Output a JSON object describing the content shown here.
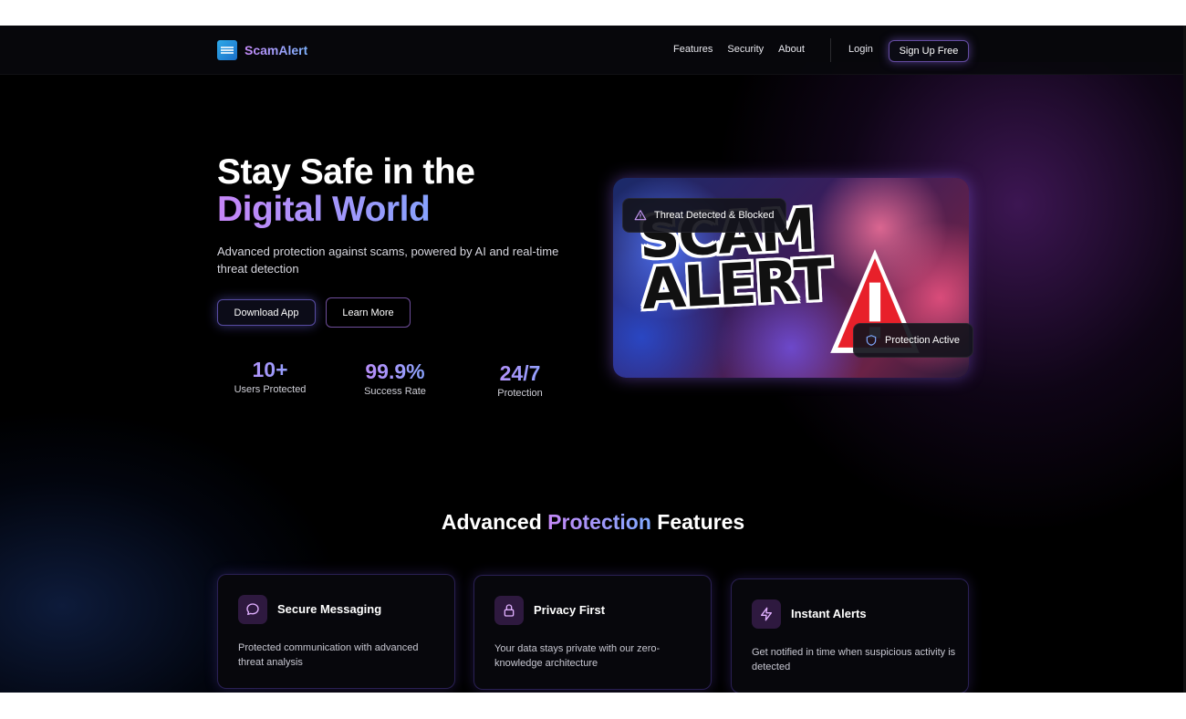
{
  "nav": {
    "brand": "ScamAlert",
    "links": [
      "Features",
      "Security",
      "About"
    ],
    "login": "Login",
    "signup": "Sign Up Free"
  },
  "hero": {
    "title_line1": "Stay Safe in the",
    "title_line2": "Digital World",
    "subtitle": "Advanced protection against scams, powered by AI and real-time threat detection",
    "download_button": "Download App",
    "learn_button": "Learn More",
    "stats": [
      {
        "value": "10+",
        "label": "Users Protected"
      },
      {
        "value": "99.9%",
        "label": "Success Rate"
      },
      {
        "value": "24/7",
        "label": "Protection"
      }
    ],
    "image": {
      "text_line1": "SCAM",
      "text_line2": "ALERT",
      "threat_badge": "Threat Detected & Blocked",
      "active_badge": "Protection Active"
    }
  },
  "features": {
    "title_pre": "Advanced ",
    "title_accent": "Protection",
    "title_post": " Features",
    "cards": [
      {
        "icon": "message-icon",
        "title": "Secure Messaging",
        "description": "Protected communication with advanced threat analysis"
      },
      {
        "icon": "lock-icon",
        "title": "Privacy First",
        "description": "Your data stays private with our zero-knowledge architecture"
      },
      {
        "icon": "zap-icon",
        "title": "Instant Alerts",
        "description": "Get notified in time when suspicious activity is detected"
      }
    ]
  },
  "colors": {
    "accent_purple": "#c488f7",
    "accent_blue": "#7fa9ff",
    "background": "#000000",
    "icon_tint": "#c070e8"
  }
}
